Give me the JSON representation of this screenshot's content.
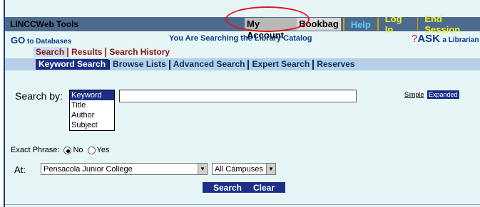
{
  "toolbar": {
    "title": "LINCCWeb Tools",
    "my_account": "My Account",
    "bookbag": "Bookbag",
    "help": "Help",
    "login": "Log In",
    "end_session": "End Session"
  },
  "subheader": {
    "go_big": "GO",
    "go_rest": "to Databases",
    "searching": "You Are Searching the Library Catalog",
    "ask_big": "ASK",
    "ask_small": "a Librarian"
  },
  "tabs": [
    "Search",
    "Results",
    "Search History"
  ],
  "search_types": [
    "Keyword Search",
    "Browse Lists",
    "Advanced Search",
    "Expert Search",
    "Reserves"
  ],
  "form": {
    "search_by_label": "Search by:",
    "search_by_options": [
      "Keyword",
      "Title",
      "Author",
      "Subject"
    ],
    "search_value": "",
    "mode_simple": "Simple",
    "mode_expanded": "Expanded",
    "exact_phrase_label": "Exact Phrase:",
    "exact_no": "No",
    "exact_yes": "Yes",
    "at_label": "At:",
    "college": "Pensacola Junior College",
    "campus": "All Campuses",
    "search_button": "Search",
    "clear_button": "Clear"
  },
  "colors": {
    "accent": "#1b2f86",
    "topbar": "#4d6b8e",
    "highlight_oval": "#e0161b"
  }
}
